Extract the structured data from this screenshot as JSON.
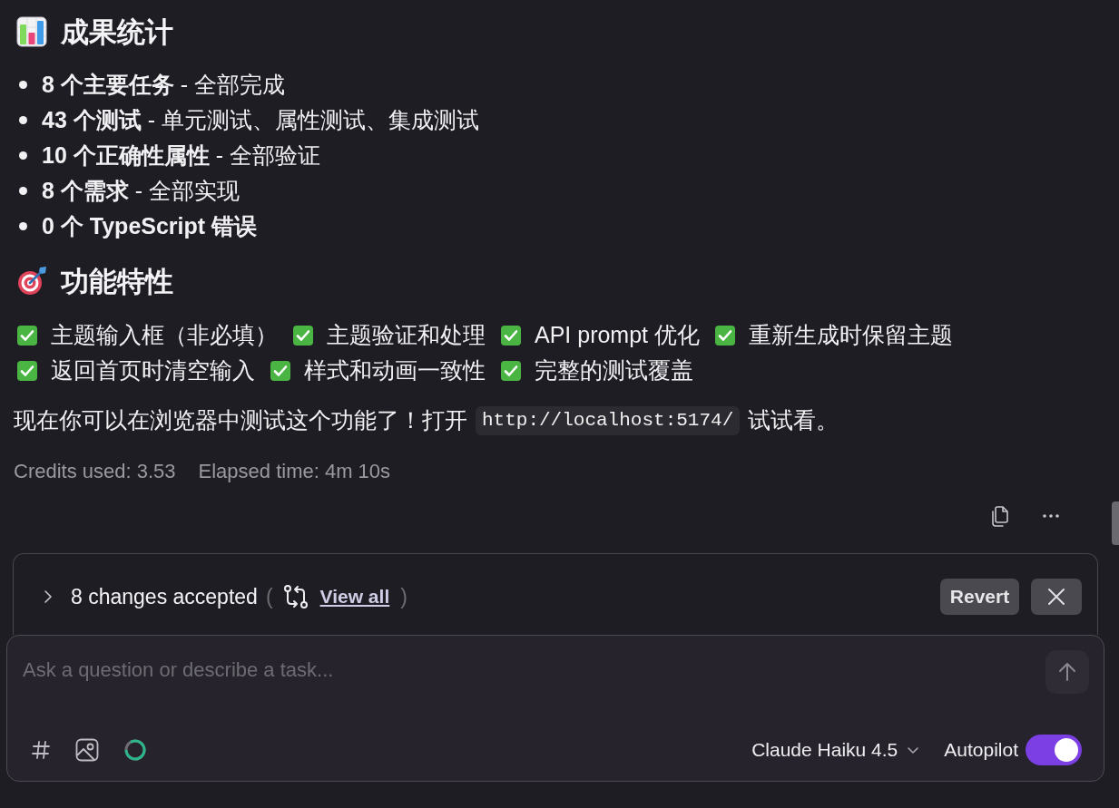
{
  "stats": {
    "heading": "成果统计",
    "items": [
      "**8 个主要任务** - 全部完成",
      "**43 个测试** - 单元测试、属性测试、集成测试",
      "**10 个正确性属性** - 全部验证",
      "**8 个需求** - 全部实现",
      "**0 个 TypeScript 错误**"
    ]
  },
  "features": {
    "heading": "功能特性",
    "items": [
      "主题输入框（非必填）",
      "主题验证和处理",
      "API prompt 优化",
      "重新生成时保留主题",
      "返回首页时清空输入",
      "样式和动画一致性",
      "完整的测试覆盖"
    ]
  },
  "note": {
    "before": "现在你可以在浏览器中测试这个功能了！打开",
    "code": "http://localhost:5174/",
    "after": "试试看。"
  },
  "meta": {
    "credits": "Credits used: 3.53",
    "elapsed": "Elapsed time: 4m 10s"
  },
  "changes": {
    "expanded": false,
    "summary": "8 changes accepted",
    "open_paren": "(",
    "link": "View all",
    "close_paren": ")",
    "button": "Revert"
  },
  "composer": {
    "placeholder": "Ask a question or describe a task...",
    "model": "Claude Haiku 4.5",
    "autopilot": {
      "label": "Autopilot",
      "on": true
    }
  }
}
